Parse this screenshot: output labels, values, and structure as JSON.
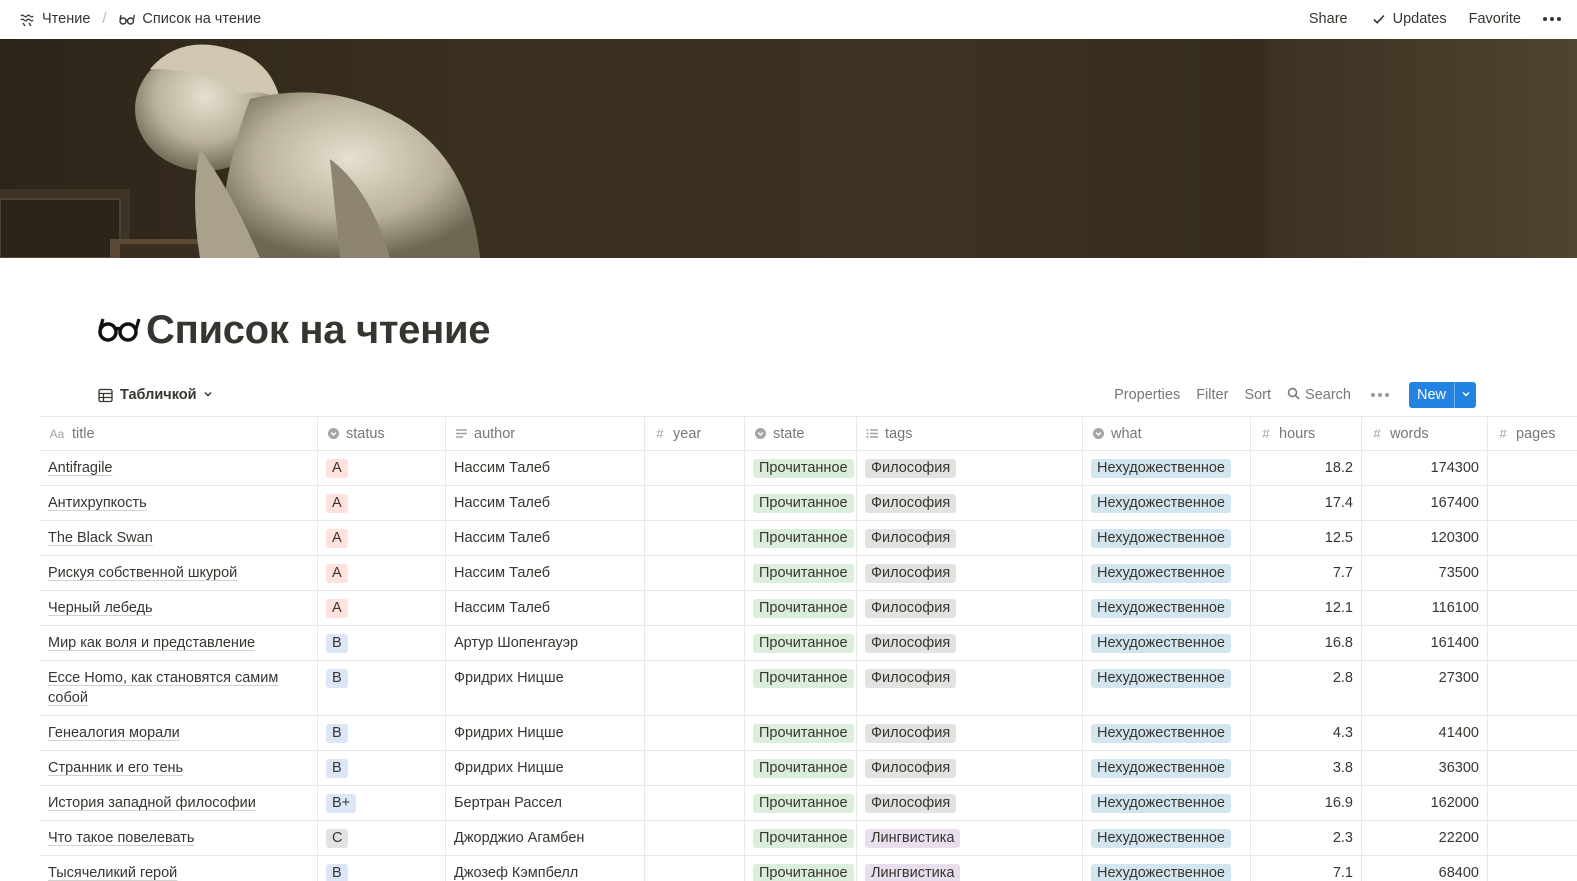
{
  "breadcrumb": {
    "parent": "Чтение",
    "current": "Список на чтение"
  },
  "topbar": {
    "share": "Share",
    "updates": "Updates",
    "favorite": "Favorite"
  },
  "page": {
    "title": "Список на чтение"
  },
  "view": {
    "name": "Табличкой",
    "properties": "Properties",
    "filter": "Filter",
    "sort": "Sort",
    "search": "Search",
    "new": "New"
  },
  "columns": {
    "title": "title",
    "status": "status",
    "author": "author",
    "year": "year",
    "state": "state",
    "tags": "tags",
    "what": "what",
    "hours": "hours",
    "words": "words",
    "pages": "pages"
  },
  "colors": {
    "accent": "#2383e2",
    "status_A": "#ffe2dd",
    "status_B": "#dde6f7",
    "status_C": "#e3e2e0",
    "state_green": "#dbeddb",
    "tag_gray": "#e3e2e0",
    "tag_purple": "#e8deee",
    "what_blue": "#d3e5ef"
  },
  "rows": [
    {
      "title": "Antifragile",
      "status": "A",
      "author": "Нассим Талеб",
      "year": "",
      "state": "Прочитанное",
      "tags": "Философия",
      "what": "Нехудожественное",
      "hours": "18.2",
      "words": "174300",
      "pages": ""
    },
    {
      "title": "Антихрупкость",
      "status": "A",
      "author": "Нассим Талеб",
      "year": "",
      "state": "Прочитанное",
      "tags": "Философия",
      "what": "Нехудожественное",
      "hours": "17.4",
      "words": "167400",
      "pages": ""
    },
    {
      "title": "The Black Swan",
      "status": "A",
      "author": "Нассим Талеб",
      "year": "",
      "state": "Прочитанное",
      "tags": "Философия",
      "what": "Нехудожественное",
      "hours": "12.5",
      "words": "120300",
      "pages": ""
    },
    {
      "title": "Рискуя собственной шкурой",
      "status": "A",
      "author": "Нассим Талеб",
      "year": "",
      "state": "Прочитанное",
      "tags": "Философия",
      "what": "Нехудожественное",
      "hours": "7.7",
      "words": "73500",
      "pages": ""
    },
    {
      "title": "Черный лебедь",
      "status": "A",
      "author": "Нассим Талеб",
      "year": "",
      "state": "Прочитанное",
      "tags": "Философия",
      "what": "Нехудожественное",
      "hours": "12.1",
      "words": "116100",
      "pages": ""
    },
    {
      "title": "Мир как воля и представление",
      "status": "B",
      "author": "Артур Шопенгауэр",
      "year": "",
      "state": "Прочитанное",
      "tags": "Философия",
      "what": "Нехудожественное",
      "hours": "16.8",
      "words": "161400",
      "pages": ""
    },
    {
      "title": "Ecce Homo, как становятся самим собой",
      "status": "B",
      "author": "Фридрих Ницше",
      "year": "",
      "state": "Прочитанное",
      "tags": "Философия",
      "what": "Нехудожественное",
      "hours": "2.8",
      "words": "27300",
      "pages": ""
    },
    {
      "title": "Генеалогия морали",
      "status": "B",
      "author": "Фридрих Ницше",
      "year": "",
      "state": "Прочитанное",
      "tags": "Философия",
      "what": "Нехудожественное",
      "hours": "4.3",
      "words": "41400",
      "pages": ""
    },
    {
      "title": "Странник и его тень",
      "status": "B",
      "author": "Фридрих Ницше",
      "year": "",
      "state": "Прочитанное",
      "tags": "Философия",
      "what": "Нехудожественное",
      "hours": "3.8",
      "words": "36300",
      "pages": ""
    },
    {
      "title": "История западной философии",
      "status": "B+",
      "author": "Бертран Рассел",
      "year": "",
      "state": "Прочитанное",
      "tags": "Философия",
      "what": "Нехудожественное",
      "hours": "16.9",
      "words": "162000",
      "pages": ""
    },
    {
      "title": "Что такое повелевать",
      "status": "C",
      "author": "Джорджио Агамбен",
      "year": "",
      "state": "Прочитанное",
      "tags": "Лингвистика",
      "what": "Нехудожественное",
      "hours": "2.3",
      "words": "22200",
      "pages": ""
    },
    {
      "title": "Тысячеликий герой",
      "status": "B",
      "author": "Джозеф Кэмпбелл",
      "year": "",
      "state": "Прочитанное",
      "tags": "Лингвистика",
      "what": "Нехудожественное",
      "hours": "7.1",
      "words": "68400",
      "pages": ""
    }
  ]
}
